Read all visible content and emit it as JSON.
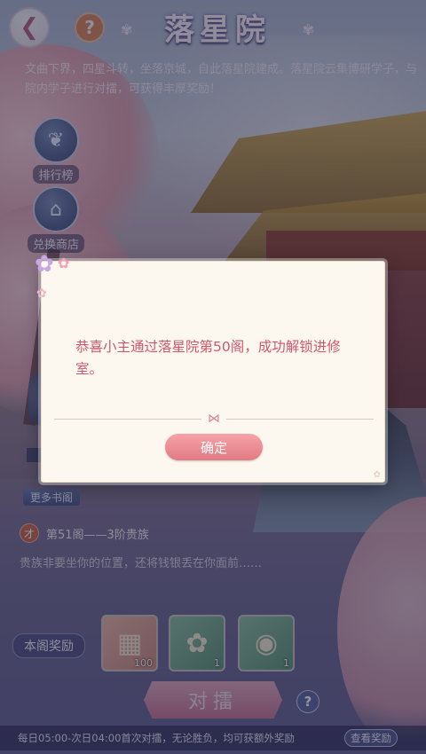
{
  "header": {
    "back_icon": "back-arrow-icon",
    "help_label": "?",
    "title": "落星院"
  },
  "intro": {
    "text": "文曲下界，四星斗转，坐落京城，自此落星院建成。落星院云集博研学子，与院内学子进行对擂，可获得丰厚奖励！"
  },
  "side_menu": [
    {
      "label": "排行榜",
      "icon": "phoenix-icon"
    },
    {
      "label": "兑换商店",
      "icon": "shop-icon"
    }
  ],
  "level": {
    "more_label": "更多书阁",
    "badge": "才",
    "name": "第51阁——3阶贵族",
    "description": "贵族非要坐你的位置，还将钱银丢在你面前……"
  },
  "rewards": {
    "label": "本阁奖励",
    "items": [
      {
        "name": "bamboo-scroll",
        "icon": "scroll-icon",
        "count": "100"
      },
      {
        "name": "feather-fan",
        "icon": "fan-icon",
        "count": "1"
      },
      {
        "name": "dumpling-plate",
        "icon": "food-icon",
        "count": "1"
      }
    ]
  },
  "actions": {
    "duel_label": "对擂",
    "help_label": "?"
  },
  "footer": {
    "text": "每日05:00-次日04:00首次对擂，无论胜负，均可获额外奖励",
    "view_reward_label": "查看奖励"
  },
  "modal": {
    "message": "恭喜小主通过落星院第50阁，成功解锁进修室。",
    "confirm_label": "确定"
  },
  "colors": {
    "modal_text": "#d0566c",
    "confirm_button": "#e07a82",
    "modal_background": "#fdf8ef"
  }
}
